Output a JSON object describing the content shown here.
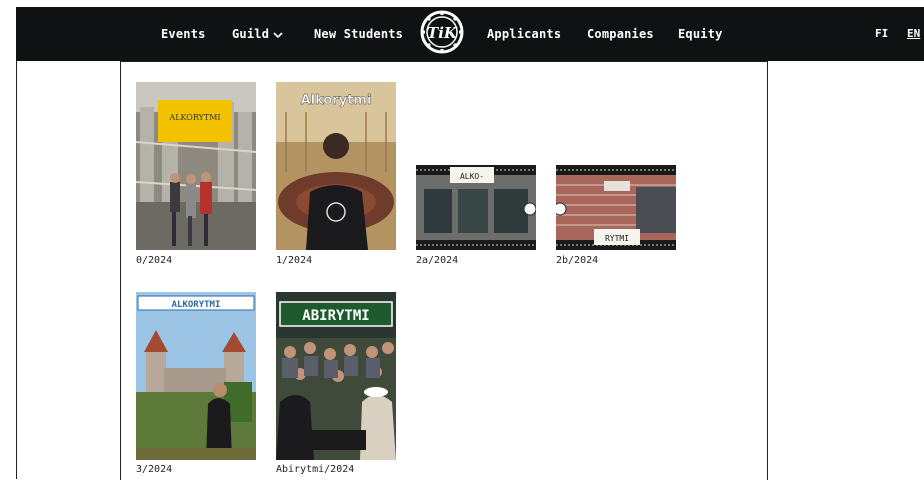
{
  "nav": {
    "items": [
      "Events",
      "Guild",
      "New Students",
      "Applicants",
      "Companies",
      "Equity"
    ],
    "logo_text": "TiK",
    "lang_fi": "FI",
    "lang_en": "EN"
  },
  "covers": [
    {
      "label": "0/2024",
      "title": "ALKORYTMI"
    },
    {
      "label": "1/2024",
      "title": "Alkorytmi"
    },
    {
      "label": "2a/2024",
      "title": "ALKO-"
    },
    {
      "label": "2b/2024",
      "title": "RYTMI"
    },
    {
      "label": "3/2024",
      "title": "ALKORYTMI"
    },
    {
      "label": "Abirytmi/2024",
      "title": "ABIRYTMI"
    }
  ],
  "colors": {
    "nav_bg": "#101113",
    "accent_yellow": "#f2c200"
  }
}
